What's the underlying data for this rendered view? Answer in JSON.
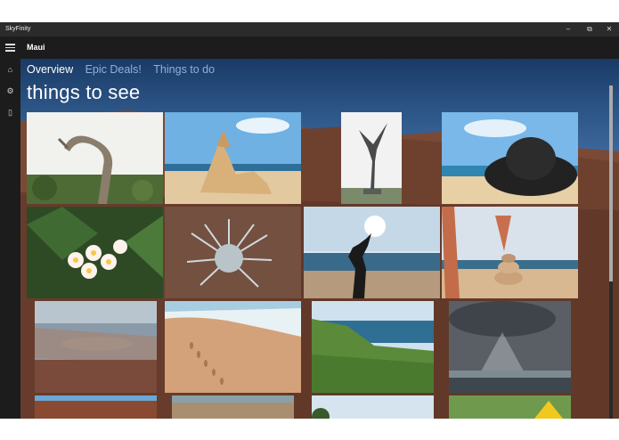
{
  "window": {
    "title": "SkyFinity",
    "controls": {
      "minimize": "–",
      "maximize": "⧉",
      "close": "✕"
    }
  },
  "appbar": {
    "location": "Maui",
    "menu_icon": "hamburger-icon"
  },
  "sidebar": {
    "items": [
      {
        "name": "home",
        "icon": "home-icon",
        "glyph": "⌂"
      },
      {
        "name": "settings",
        "icon": "gear-icon",
        "glyph": "⚙"
      },
      {
        "name": "saved",
        "icon": "clipboard-icon",
        "glyph": "▯"
      }
    ]
  },
  "tabs": [
    {
      "label": "Overview",
      "active": true
    },
    {
      "label": "Epic Deals!",
      "active": false
    },
    {
      "label": "Things to do",
      "active": false
    }
  ],
  "section": {
    "title": "things to see"
  },
  "colors": {
    "accent": "#8fb0d8",
    "titlebar": "#2b2b2b",
    "appbar": "#1c1c1c"
  },
  "photos": [
    {
      "name": "driftwood-photo",
      "subject": "driftwood"
    },
    {
      "name": "rock-pile-photo",
      "subject": "rock formation on beach"
    },
    {
      "name": "bird-statue-photo",
      "subject": "bird statue"
    },
    {
      "name": "hat-photo",
      "subject": "black sun hat on beach"
    },
    {
      "name": "plumeria-photo",
      "subject": "plumeria flowers"
    },
    {
      "name": "silversword-photo",
      "subject": "silversword plant"
    },
    {
      "name": "silhouette-photo",
      "subject": "person drinking at sunset"
    },
    {
      "name": "cairn-photo",
      "subject": "stone cairn with legs"
    },
    {
      "name": "crater-photo",
      "subject": "volcanic crater"
    },
    {
      "name": "footprints-photo",
      "subject": "footprints in sand"
    },
    {
      "name": "coast-photo",
      "subject": "green coastline"
    },
    {
      "name": "cloud-rays-photo",
      "subject": "sun rays through clouds"
    },
    {
      "name": "red-crater-photo",
      "subject": "red crater landscape"
    },
    {
      "name": "desert-photo",
      "subject": "desert hills"
    },
    {
      "name": "trees-photo",
      "subject": "trees and sky"
    },
    {
      "name": "sign-photo",
      "subject": "yellow road sign"
    }
  ]
}
